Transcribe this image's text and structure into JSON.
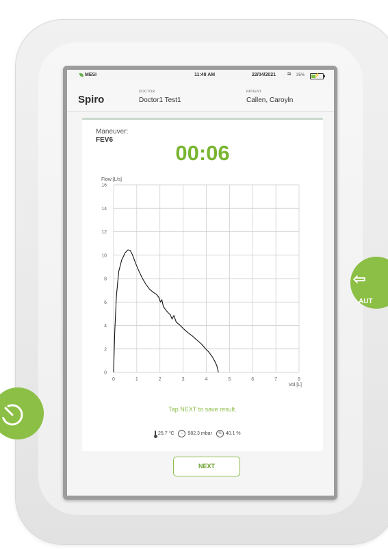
{
  "statusbar": {
    "brand": "MESI",
    "time": "11:48 AM",
    "date": "22/04/2021",
    "battery_pct": "35%",
    "battery_level": 0.35
  },
  "header": {
    "title": "Spiro",
    "doctor_label": "DOCTOR",
    "doctor_name": "Doctor1 Test1",
    "patient_label": "PATIENT",
    "patient_name": "Callen, Caroyln"
  },
  "maneuver": {
    "label": "Maneuver:",
    "value": "FEV6"
  },
  "timer": "00:06",
  "hint": "Tap NEXT to save result.",
  "environment": {
    "temperature": "25.7 °C",
    "pressure": "982.3 mbar",
    "humidity": "40.1 %"
  },
  "next_label": "NEXT",
  "side_button": {
    "label": "AUT"
  },
  "colors": {
    "accent": "#7ab532",
    "button_green": "#8cbf45"
  },
  "chart_data": {
    "type": "line",
    "ylabel": "Flow [L/s]",
    "xlabel": "Vol [L]",
    "xlim": [
      0,
      8
    ],
    "ylim": [
      0,
      16
    ],
    "x_ticks": [
      0,
      1,
      2,
      3,
      4,
      5,
      6,
      7,
      8
    ],
    "y_ticks": [
      0,
      2,
      4,
      6,
      8,
      10,
      12,
      14,
      16
    ],
    "grid": true,
    "series": [
      {
        "points": [
          [
            0.0,
            0.0
          ],
          [
            0.05,
            3.5
          ],
          [
            0.12,
            6.5
          ],
          [
            0.22,
            8.6
          ],
          [
            0.35,
            9.6
          ],
          [
            0.5,
            10.2
          ],
          [
            0.62,
            10.45
          ],
          [
            0.72,
            10.4
          ],
          [
            0.82,
            10.0
          ],
          [
            0.95,
            9.3
          ],
          [
            1.1,
            8.6
          ],
          [
            1.25,
            8.0
          ],
          [
            1.4,
            7.5
          ],
          [
            1.55,
            7.1
          ],
          [
            1.7,
            6.85
          ],
          [
            1.85,
            6.65
          ],
          [
            1.95,
            6.4
          ],
          [
            2.02,
            6.0
          ],
          [
            2.08,
            6.2
          ],
          [
            2.15,
            5.6
          ],
          [
            2.3,
            5.2
          ],
          [
            2.45,
            4.9
          ],
          [
            2.52,
            4.55
          ],
          [
            2.6,
            4.85
          ],
          [
            2.7,
            4.3
          ],
          [
            2.85,
            4.05
          ],
          [
            3.0,
            3.75
          ],
          [
            3.2,
            3.4
          ],
          [
            3.4,
            3.1
          ],
          [
            3.6,
            2.75
          ],
          [
            3.8,
            2.4
          ],
          [
            3.95,
            2.05
          ],
          [
            4.1,
            1.75
          ],
          [
            4.25,
            1.35
          ],
          [
            4.35,
            1.0
          ],
          [
            4.45,
            0.6
          ],
          [
            4.5,
            0.2
          ],
          [
            4.52,
            0.0
          ]
        ]
      }
    ]
  }
}
